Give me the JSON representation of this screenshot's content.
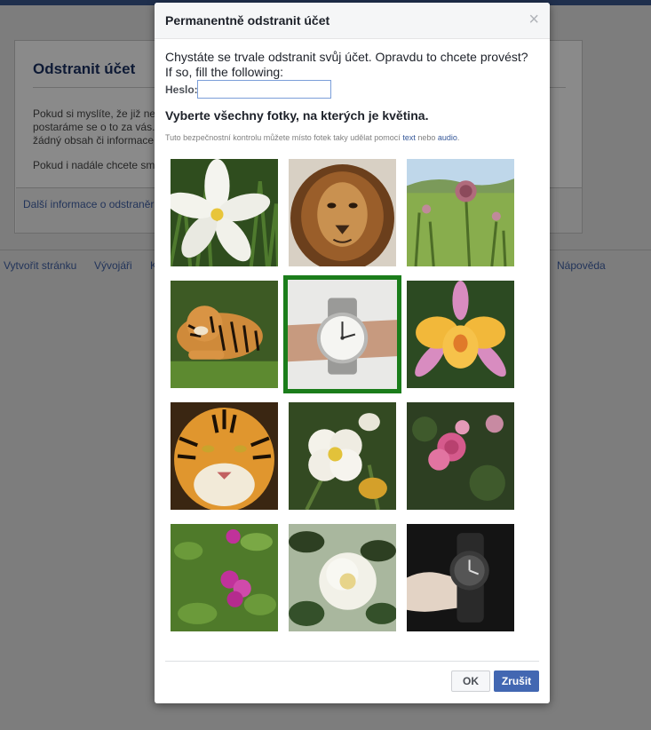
{
  "background_page": {
    "card_title": "Odstranit účet",
    "paragraph_lines": [
      "Pokud si myslíte, že již ne",
      "postaráme se o to za vás.",
      "žádný obsah či informace"
    ],
    "question_text": "Pokud i nadále chcete sm",
    "more_info_link": "Další informace o odstraněr",
    "nav": {
      "create_page": "Vytvořit stránku",
      "developers": "Vývojáři",
      "truncated": "K",
      "help": "Nápověda"
    }
  },
  "dialog": {
    "title": "Permanentně odstranit účet",
    "close_glyph": "×",
    "intro_line1": "Chystáte se trvale odstranit svůj účet. Opravdu to chcete provést?",
    "intro_line2": "If so, fill the following:",
    "password_label": "Heslo:",
    "password_value": "",
    "captcha_question": "Vyberte všechny fotky, na kterých je květina.",
    "captcha_hint_prefix": "Tuto bezpečnostní kontrolu můžete místo fotek taky udělat pomocí ",
    "captcha_hint_text_link": "text",
    "captcha_hint_middle": " nebo ",
    "captcha_hint_audio_link": "audio",
    "captcha_hint_suffix": ".",
    "photos": [
      {
        "subject": "white-flower",
        "selected": false
      },
      {
        "subject": "lion",
        "selected": false
      },
      {
        "subject": "thistle-meadow",
        "selected": false
      },
      {
        "subject": "lying-tiger",
        "selected": false
      },
      {
        "subject": "wristwatch",
        "selected": true
      },
      {
        "subject": "yellow-orchid",
        "selected": false
      },
      {
        "subject": "tiger-face",
        "selected": false
      },
      {
        "subject": "white-poppy",
        "selected": false
      },
      {
        "subject": "pink-roses",
        "selected": false
      },
      {
        "subject": "pink-bougainvillea",
        "selected": false
      },
      {
        "subject": "white-camellia",
        "selected": false
      },
      {
        "subject": "watch-in-hand",
        "selected": false
      }
    ],
    "ok_label": "OK",
    "cancel_label": "Zrušit"
  },
  "colors": {
    "selected_border": "#1b7d1b",
    "primary_button": "#4267b2",
    "link": "#365899"
  }
}
